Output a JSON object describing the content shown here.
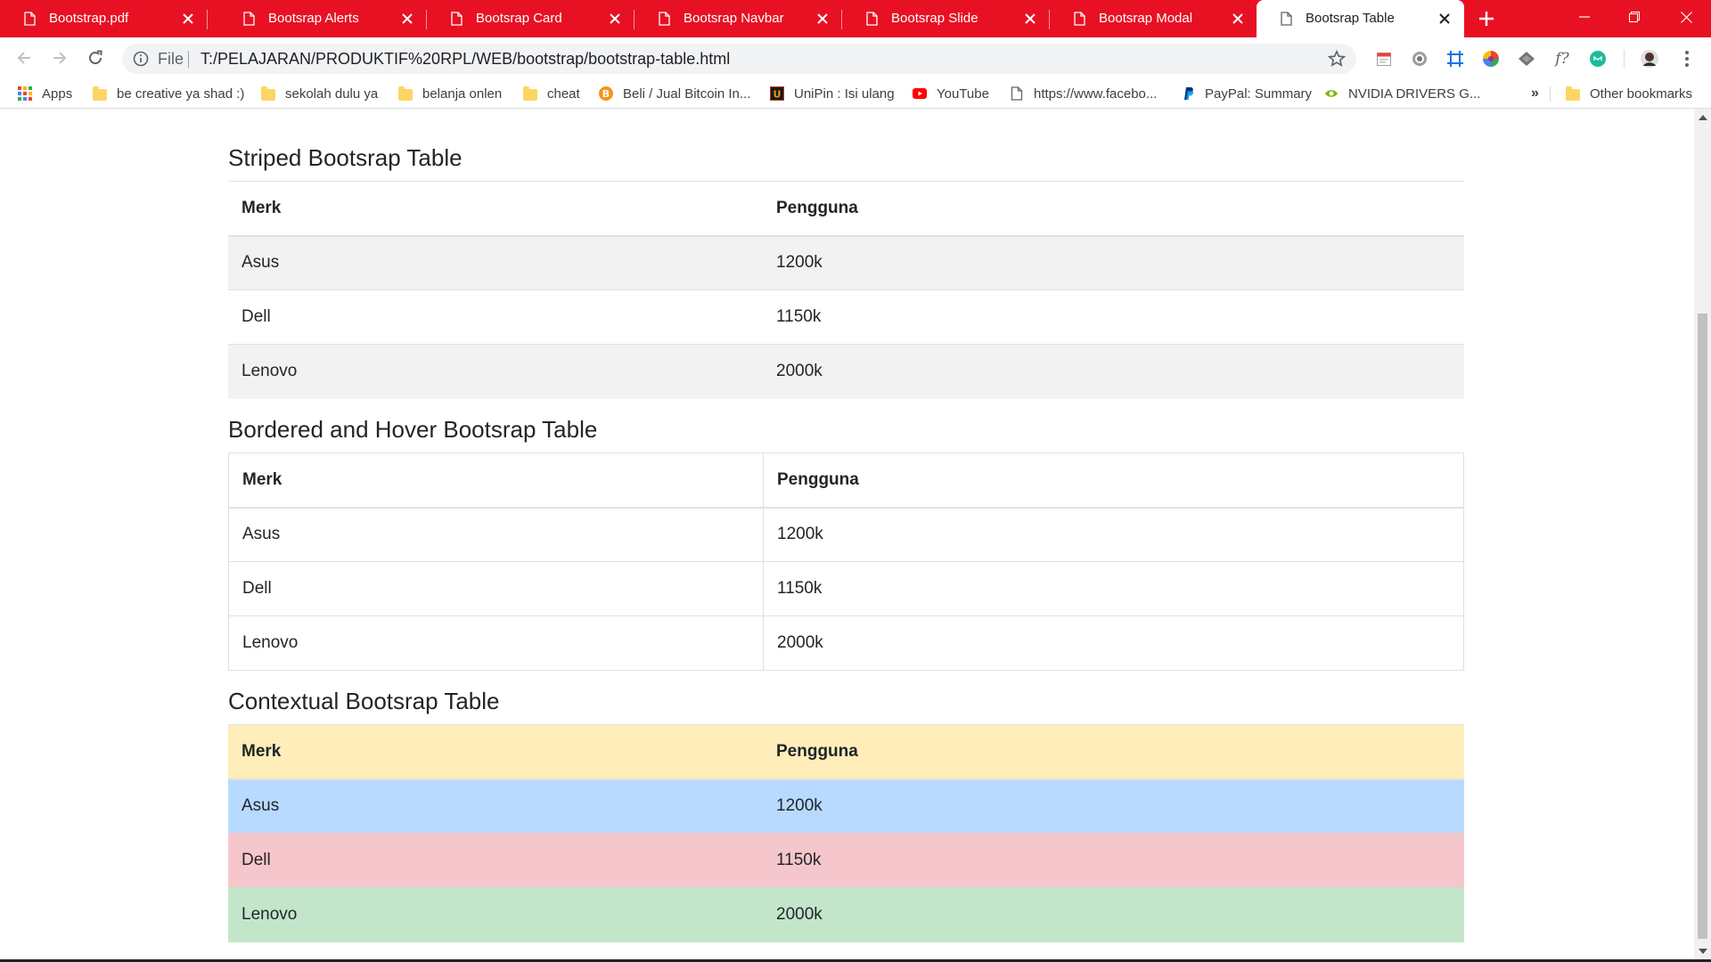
{
  "browser": {
    "tabs": [
      {
        "title": "Bootstrap.pdf",
        "active": false
      },
      {
        "title": "Bootsrap Alerts",
        "active": false
      },
      {
        "title": "Bootsrap Card",
        "active": false
      },
      {
        "title": "Bootsrap Navbar",
        "active": false
      },
      {
        "title": "Bootsrap Slide",
        "active": false
      },
      {
        "title": "Bootsrap Modal",
        "active": false
      },
      {
        "title": "Bootsrap Table",
        "active": true
      }
    ],
    "tab_icon": "page-icon",
    "new_tab_icon": "plus-icon",
    "window_controls": [
      "minimize-icon",
      "restore-icon",
      "close-icon"
    ],
    "accent_color": "#e81123",
    "omnibox": {
      "scheme_label": "File",
      "url": "T:/PELAJARAN/PRODUKTIF%20RPL/WEB/bootstrap/bootstrap-table.html"
    },
    "bookmarks": [
      {
        "label": "Apps",
        "icon": "apps-grid-icon"
      },
      {
        "label": "be creative ya shad :)",
        "icon": "folder-icon"
      },
      {
        "label": "sekolah dulu ya",
        "icon": "folder-icon"
      },
      {
        "label": "belanja onlen",
        "icon": "folder-icon"
      },
      {
        "label": "cheat",
        "icon": "folder-icon"
      },
      {
        "label": "Beli / Jual Bitcoin In...",
        "icon": "bitcoin-icon"
      },
      {
        "label": "UniPin : Isi ulang",
        "icon": "unipin-icon"
      },
      {
        "label": "YouTube",
        "icon": "youtube-icon"
      },
      {
        "label": "https://www.facebo...",
        "icon": "page-icon"
      },
      {
        "label": "PayPal: Summary",
        "icon": "paypal-icon"
      },
      {
        "label": "NVIDIA DRIVERS G...",
        "icon": "nvidia-icon"
      }
    ],
    "bookmarks_overflow": "»",
    "other_bookmarks": "Other bookmarks",
    "extensions_formula_label": "f?"
  },
  "page": {
    "sections": [
      {
        "title": "Striped Bootsrap Table",
        "headers": [
          "Merk",
          "Pengguna"
        ],
        "rows": [
          [
            "Asus",
            "1200k"
          ],
          [
            "Dell",
            "1150k"
          ],
          [
            "Lenovo",
            "2000k"
          ]
        ]
      },
      {
        "title": "Bordered and Hover Bootsrap Table",
        "headers": [
          "Merk",
          "Pengguna"
        ],
        "rows": [
          [
            "Asus",
            "1200k"
          ],
          [
            "Dell",
            "1150k"
          ],
          [
            "Lenovo",
            "2000k"
          ]
        ]
      },
      {
        "title": "Contextual Bootsrap Table",
        "headers": [
          "Merk",
          "Pengguna"
        ],
        "rows": [
          [
            "Asus",
            "1200k"
          ],
          [
            "Dell",
            "1150k"
          ],
          [
            "Lenovo",
            "2000k"
          ]
        ],
        "row_contexts": [
          "primary",
          "danger",
          "success"
        ],
        "header_context": "warning",
        "context_colors": {
          "warning": "#ffeeba",
          "primary": "#b8daff",
          "danger": "#f5c6cb",
          "success": "#c3e6cb"
        }
      }
    ]
  }
}
